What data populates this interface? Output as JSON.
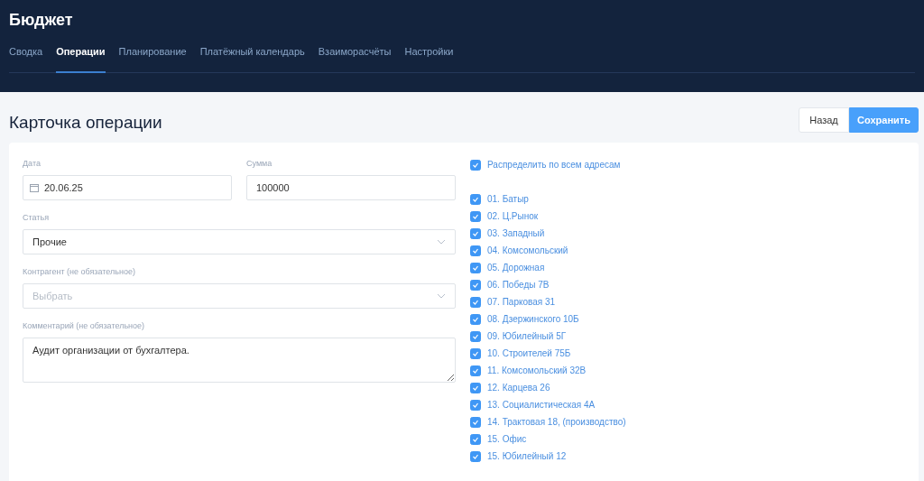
{
  "app": {
    "title": "Бюджет"
  },
  "tabs": [
    {
      "label": "Сводка",
      "selected": false
    },
    {
      "label": "Операции",
      "selected": true
    },
    {
      "label": "Планирование",
      "selected": false
    },
    {
      "label": "Платёжный календарь",
      "selected": false
    },
    {
      "label": "Взаиморасчёты",
      "selected": false
    },
    {
      "label": "Настройки",
      "selected": false
    }
  ],
  "page": {
    "title": "Карточка операции",
    "buttons": [
      {
        "label": "Назад",
        "kind": "secondary"
      },
      {
        "label": "Сохранить",
        "kind": "primary"
      }
    ]
  },
  "form": {
    "date": {
      "label": "Дата",
      "value": "20.06.25"
    },
    "amount": {
      "label": "Сумма",
      "value": "100000"
    },
    "category": {
      "label": "Статья",
      "value": "Прочие"
    },
    "counterparty": {
      "label": "Контрагент (не обязательное)",
      "placeholder": "Выбрать"
    },
    "comment": {
      "label": "Комментарий (не обязательное)",
      "value": "Аудит организации от бухгалтера."
    }
  },
  "distribute_all": {
    "label": "Распределить по всем адресам",
    "checked": true
  },
  "addresses": [
    {
      "label": "01. Батыр",
      "checked": true
    },
    {
      "label": "02. Ц.Рынок",
      "checked": true
    },
    {
      "label": "03. Западный",
      "checked": true
    },
    {
      "label": "04. Комсомольский",
      "checked": true
    },
    {
      "label": "05. Дорожная",
      "checked": true
    },
    {
      "label": "06. Победы 7В",
      "checked": true
    },
    {
      "label": "07. Парковая 31",
      "checked": true
    },
    {
      "label": "08. Дзержинского 10Б",
      "checked": true
    },
    {
      "label": "09. Юбилейный 5Г",
      "checked": true
    },
    {
      "label": "10. Строителей 75Б",
      "checked": true
    },
    {
      "label": "11. Комсомольский 32В",
      "checked": true
    },
    {
      "label": "12. Карцева 26",
      "checked": true
    },
    {
      "label": "13. Социалистическая 4А",
      "checked": true
    },
    {
      "label": "14. Трактовая 18, (производство)",
      "checked": true
    },
    {
      "label": "15. Офис",
      "checked": true
    },
    {
      "label": "15. Юбилейный 12",
      "checked": true
    }
  ]
}
